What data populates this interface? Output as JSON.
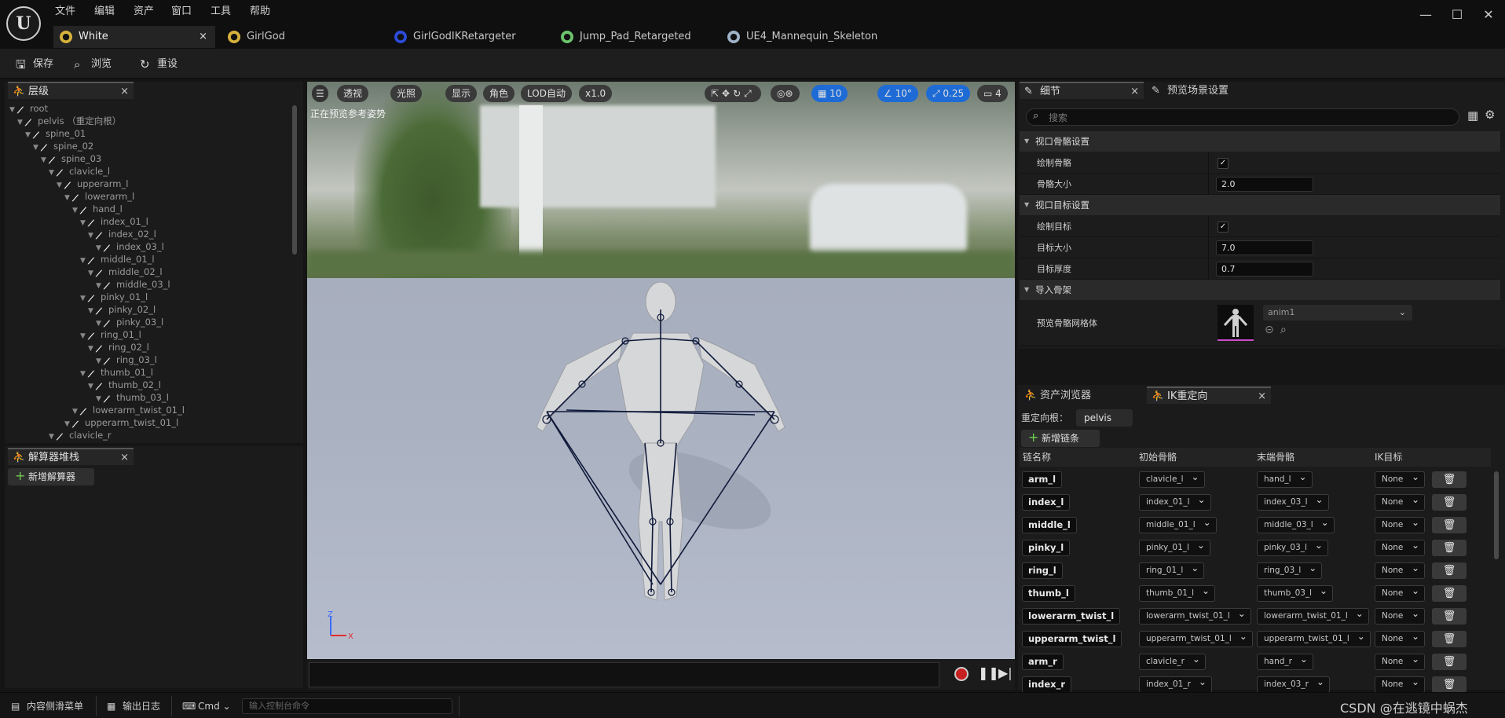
{
  "menu": [
    "文件",
    "编辑",
    "资产",
    "窗口",
    "工具",
    "帮助"
  ],
  "window_controls": [
    "—",
    "☐",
    "✕"
  ],
  "tabs": [
    {
      "label": "White",
      "icon": "asset-icon",
      "color": "#d6b13b"
    },
    {
      "label": "GirlGod",
      "icon": "asset-icon",
      "color": "#d6b13b"
    },
    {
      "label": "GirlGodIKRetargeter",
      "icon": "retargeter-icon",
      "color": "#2c4bd8"
    },
    {
      "label": "Jump_Pad_Retargeted",
      "icon": "animation-icon",
      "color": "#6cc46c"
    },
    {
      "label": "UE4_Mannequin_Skeleton",
      "icon": "skeleton-icon",
      "color": "#9fb3c8"
    }
  ],
  "toolbar": {
    "save": "保存",
    "browse": "浏览",
    "reset": "重设"
  },
  "hierarchy": {
    "title": "层级",
    "items": [
      {
        "label": "root",
        "depth": 0
      },
      {
        "label": "pelvis （重定向根）",
        "depth": 1
      },
      {
        "label": "spine_01",
        "depth": 2
      },
      {
        "label": "spine_02",
        "depth": 3
      },
      {
        "label": "spine_03",
        "depth": 4
      },
      {
        "label": "clavicle_l",
        "depth": 5
      },
      {
        "label": "upperarm_l",
        "depth": 6
      },
      {
        "label": "lowerarm_l",
        "depth": 7
      },
      {
        "label": "hand_l",
        "depth": 8
      },
      {
        "label": "index_01_l",
        "depth": 9
      },
      {
        "label": "index_02_l",
        "depth": 10
      },
      {
        "label": "index_03_l",
        "depth": 11
      },
      {
        "label": "middle_01_l",
        "depth": 9
      },
      {
        "label": "middle_02_l",
        "depth": 10
      },
      {
        "label": "middle_03_l",
        "depth": 11
      },
      {
        "label": "pinky_01_l",
        "depth": 9
      },
      {
        "label": "pinky_02_l",
        "depth": 10
      },
      {
        "label": "pinky_03_l",
        "depth": 11
      },
      {
        "label": "ring_01_l",
        "depth": 9
      },
      {
        "label": "ring_02_l",
        "depth": 10
      },
      {
        "label": "ring_03_l",
        "depth": 11
      },
      {
        "label": "thumb_01_l",
        "depth": 9
      },
      {
        "label": "thumb_02_l",
        "depth": 10
      },
      {
        "label": "thumb_03_l",
        "depth": 11
      },
      {
        "label": "lowerarm_twist_01_l",
        "depth": 8
      },
      {
        "label": "upperarm_twist_01_l",
        "depth": 7
      },
      {
        "label": "clavicle_r",
        "depth": 5
      }
    ]
  },
  "solver_stack": {
    "title": "解算器堆栈",
    "add_label": "新增解算器"
  },
  "viewport": {
    "buttons": {
      "perspective": "透视",
      "lit": "光照",
      "show": "显示",
      "character": "角色",
      "lod": "LOD自动",
      "speed": "x1.0"
    },
    "grid_value": "10",
    "angle_value": "10°",
    "scale_value": "0.25",
    "camera_value": "4",
    "status": "正在预览参考姿势",
    "axis": {
      "z": "Z",
      "x": "X"
    }
  },
  "details": {
    "tab_label": "细节",
    "preview_tab_label": "预览场景设置",
    "search_placeholder": "搜索",
    "sections": [
      {
        "title": "视口骨骼设置",
        "props": [
          {
            "label": "绘制骨骼",
            "type": "check",
            "value": "✓"
          },
          {
            "label": "骨骼大小",
            "type": "value",
            "value": "2.0"
          }
        ]
      },
      {
        "title": "视口目标设置",
        "props": [
          {
            "label": "绘制目标",
            "type": "check",
            "value": "✓"
          },
          {
            "label": "目标大小",
            "type": "value",
            "value": "7.0"
          },
          {
            "label": "目标厚度",
            "type": "value",
            "value": "0.7"
          }
        ]
      },
      {
        "title": "导入骨架",
        "props": []
      }
    ],
    "preview_mesh_label": "预览骨骼网格体",
    "preview_mesh_value": "anim1"
  },
  "ik": {
    "asset_tab": "资产浏览器",
    "ik_tab": "IK重定向",
    "root_label": "重定向根：",
    "root_value": "pelvis",
    "add_chain": "新增链条",
    "headers": [
      "链名称",
      "初始骨骼",
      "末端骨骼",
      "IK目标"
    ],
    "rows": [
      {
        "name": "arm_l",
        "start": "clavicle_l",
        "end": "hand_l",
        "goal": "None"
      },
      {
        "name": "index_l",
        "start": "index_01_l",
        "end": "index_03_l",
        "goal": "None"
      },
      {
        "name": "middle_l",
        "start": "middle_01_l",
        "end": "middle_03_l",
        "goal": "None"
      },
      {
        "name": "pinky_l",
        "start": "pinky_01_l",
        "end": "pinky_03_l",
        "goal": "None"
      },
      {
        "name": "ring_l",
        "start": "ring_01_l",
        "end": "ring_03_l",
        "goal": "None"
      },
      {
        "name": "thumb_l",
        "start": "thumb_01_l",
        "end": "thumb_03_l",
        "goal": "None"
      },
      {
        "name": "lowerarm_twist_l",
        "start": "lowerarm_twist_01_l",
        "end": "lowerarm_twist_01_l",
        "goal": "None"
      },
      {
        "name": "upperarm_twist_l",
        "start": "upperarm_twist_01_l",
        "end": "upperarm_twist_01_l",
        "goal": "None"
      },
      {
        "name": "arm_r",
        "start": "clavicle_r",
        "end": "hand_r",
        "goal": "None"
      },
      {
        "name": "index_r",
        "start": "index_01_r",
        "end": "index_03_r",
        "goal": "None"
      }
    ]
  },
  "statusbar": {
    "content_drawer": "内容侧滑菜单",
    "output_log": "输出日志",
    "cmd": "Cmd",
    "console_placeholder": "输入控制台命令",
    "watermark": "CSDN @在逃镜中蜗杰"
  }
}
